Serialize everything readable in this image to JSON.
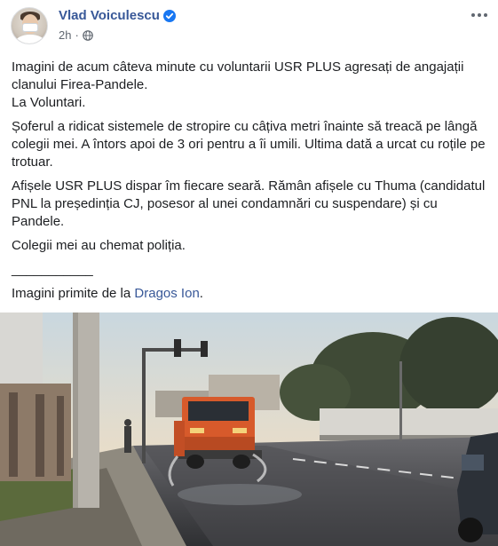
{
  "post": {
    "author": "Vlad Voiculescu",
    "timestamp": "2h",
    "separator": "·",
    "icons": {
      "verified": "verified-badge-icon",
      "audience": "globe-icon",
      "more": "more-options-icon"
    },
    "paragraphs": [
      "Imagini de acum câteva minute cu voluntarii USR PLUS agresați de angajații clanului Firea-Pandele.",
      "La Voluntari.",
      "Șoferul a ridicat sistemele de stropire cu câțiva metri înainte să treacă pe lângă colegii mei. A întors apoi de 3 ori pentru a îi umili. Ultima dată a urcat cu roțile pe trotuar.",
      "Afișele USR PLUS dispar îm fiecare seară. Rămân afișele cu Thuma (candidatul PNL la președinția CJ, posesor al unei condamnări cu suspendare) și cu Pandele.",
      "Colegii mei au chemat poliția."
    ],
    "separator_line": "___________",
    "credit_prefix": "Imagini primite de la ",
    "credit_link": "Dragos Ion",
    "credit_suffix": "."
  },
  "colors": {
    "link": "#385898",
    "text": "#1c1e21",
    "meta": "#606770",
    "verified": "#1877f2"
  }
}
